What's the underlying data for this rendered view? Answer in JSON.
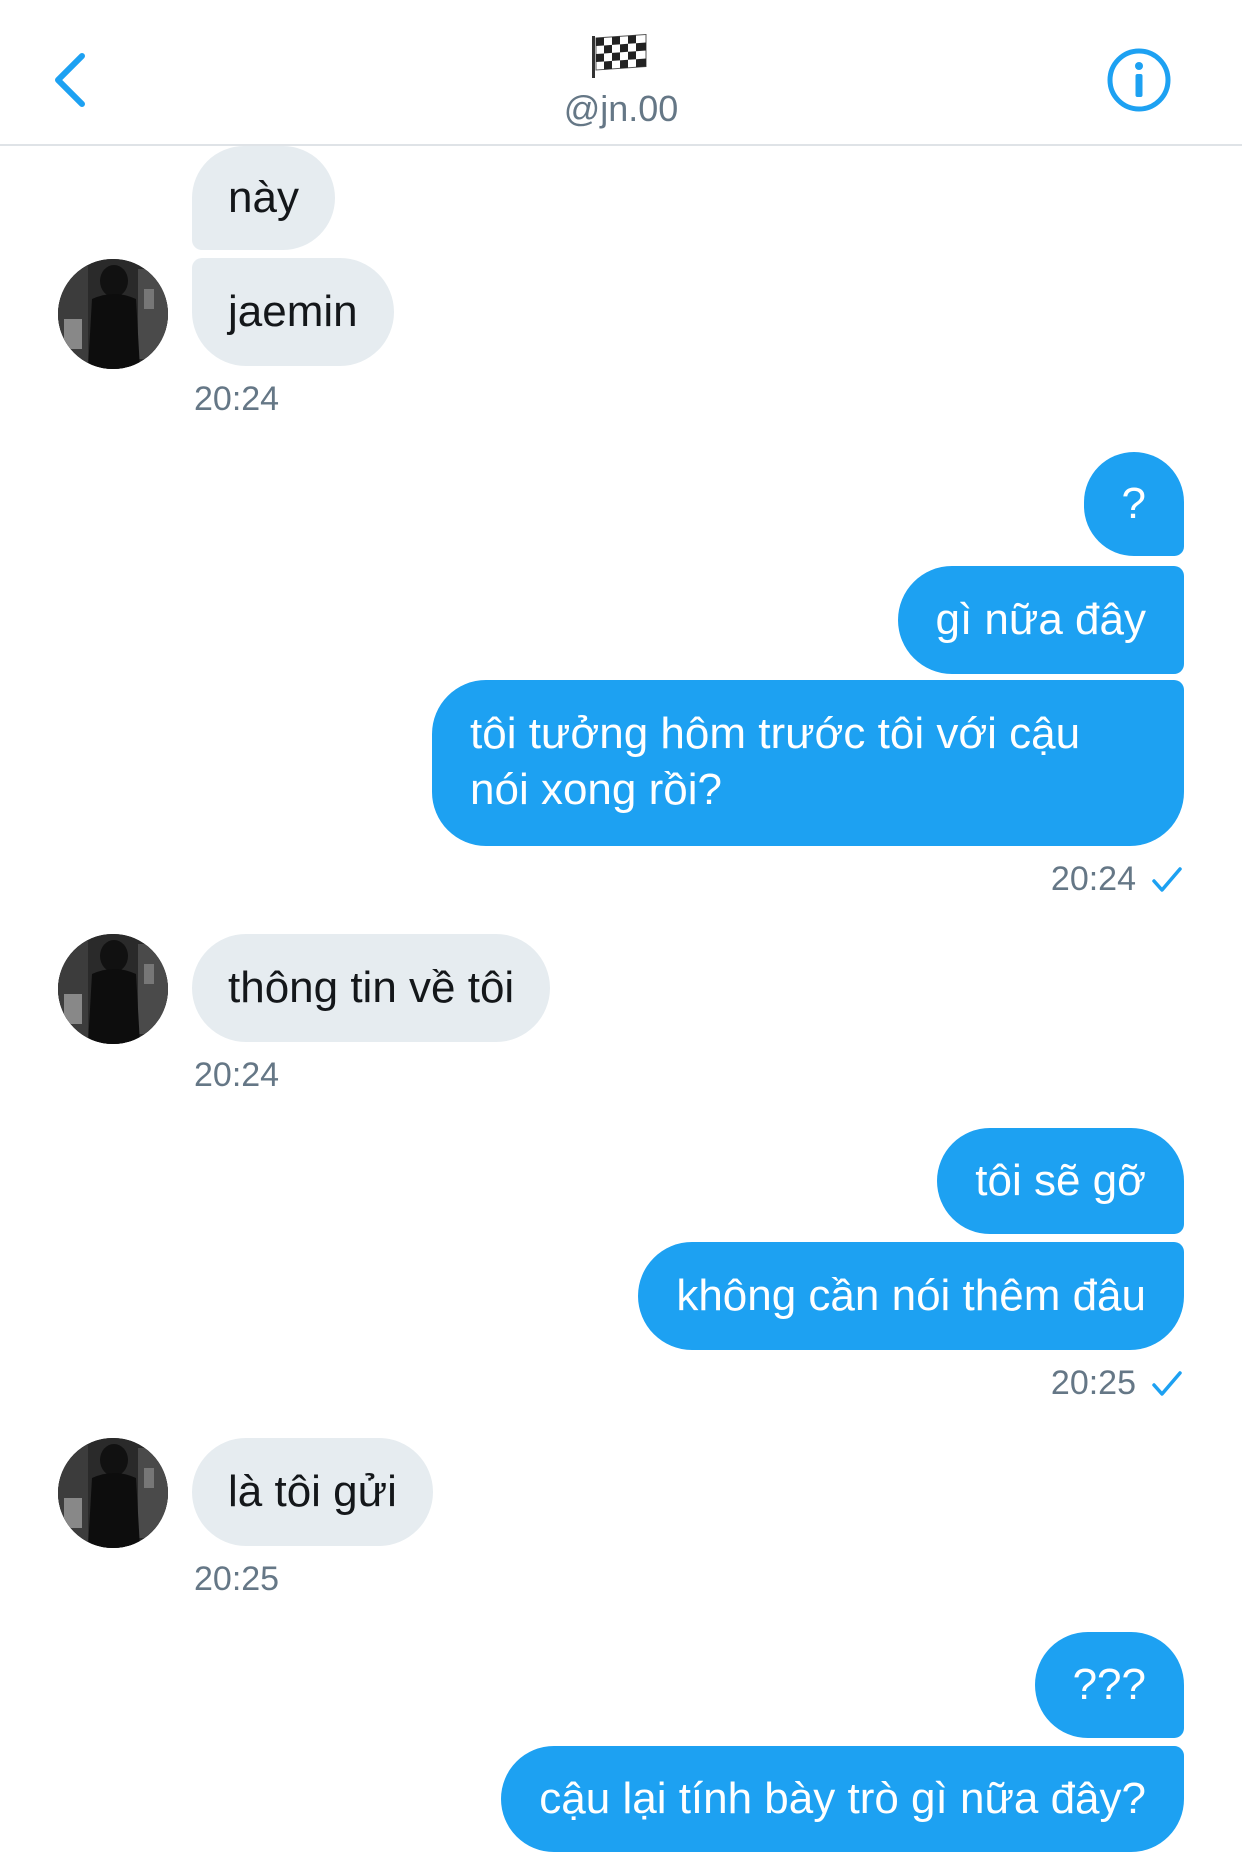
{
  "header": {
    "handle": "@jn.00",
    "back_icon": "chevron-left-icon",
    "info_icon": "info-icon",
    "title_icon": "checkered-flag-icon",
    "accent_color": "#1da1f2"
  },
  "messages": [
    {
      "side": "in",
      "text": "này"
    },
    {
      "side": "in",
      "text": "jaemin"
    },
    {
      "side": "in",
      "timestamp": "20:24"
    },
    {
      "side": "out",
      "text": "?"
    },
    {
      "side": "out",
      "text": "gì nữa đây"
    },
    {
      "side": "out",
      "text": "tôi tưởng hôm trước tôi với cậu nói xong rồi?"
    },
    {
      "side": "out",
      "timestamp": "20:24",
      "read": true
    },
    {
      "side": "in",
      "text": "thông tin về tôi"
    },
    {
      "side": "in",
      "timestamp": "20:24"
    },
    {
      "side": "out",
      "text": "tôi sẽ gỡ"
    },
    {
      "side": "out",
      "text": "không cần nói thêm đâu"
    },
    {
      "side": "out",
      "timestamp": "20:25",
      "read": true
    },
    {
      "side": "in",
      "text": "là tôi gửi"
    },
    {
      "side": "in",
      "timestamp": "20:25"
    },
    {
      "side": "out",
      "text": "???"
    },
    {
      "side": "out",
      "text": "cậu lại tính bày trò gì nữa đây?"
    }
  ]
}
